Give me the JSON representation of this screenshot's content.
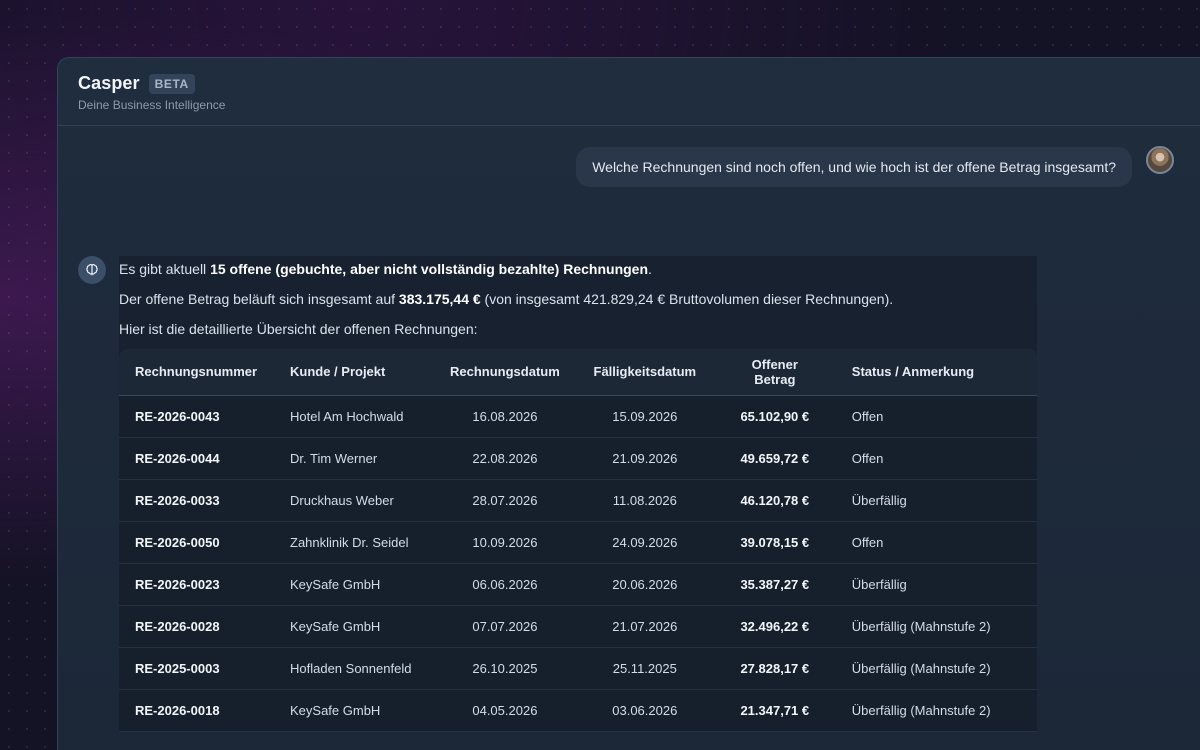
{
  "app": {
    "title": "Casper",
    "badge": "BETA",
    "subtitle": "Deine Business Intelligence"
  },
  "user_message": "Welche Rechnungen sind noch offen, und wie hoch ist der offene Betrag insgesamt?",
  "assistant": {
    "line1_prefix": "Es gibt aktuell ",
    "line1_bold": "15 offene (gebuchte, aber nicht vollständig bezahlte) Rechnungen",
    "line1_suffix": ".",
    "line2_prefix": "Der offene Betrag beläuft sich insgesamt auf ",
    "line2_bold": "383.175,44 €",
    "line2_suffix": " (von insgesamt 421.829,24 € Bruttovolumen dieser Rechnungen).",
    "line3": "Hier ist die detaillierte Übersicht der offenen Rechnungen:"
  },
  "table": {
    "headers": [
      "Rechnungsnummer",
      "Kunde / Projekt",
      "Rechnungsdatum",
      "Fälligkeitsdatum",
      "Offener Betrag",
      "Status / Anmerkung"
    ],
    "rows": [
      {
        "nr": "RE-2026-0043",
        "kunde": "Hotel Am Hochwald",
        "datum": "16.08.2026",
        "faellig": "15.09.2026",
        "betrag": "65.102,90 €",
        "status": "Offen"
      },
      {
        "nr": "RE-2026-0044",
        "kunde": "Dr. Tim Werner",
        "datum": "22.08.2026",
        "faellig": "21.09.2026",
        "betrag": "49.659,72 €",
        "status": "Offen"
      },
      {
        "nr": "RE-2026-0033",
        "kunde": "Druckhaus Weber",
        "datum": "28.07.2026",
        "faellig": "11.08.2026",
        "betrag": "46.120,78 €",
        "status": "Überfällig"
      },
      {
        "nr": "RE-2026-0050",
        "kunde": "Zahnklinik Dr. Seidel",
        "datum": "10.09.2026",
        "faellig": "24.09.2026",
        "betrag": "39.078,15 €",
        "status": "Offen"
      },
      {
        "nr": "RE-2026-0023",
        "kunde": "KeySafe GmbH",
        "datum": "06.06.2026",
        "faellig": "20.06.2026",
        "betrag": "35.387,27 €",
        "status": "Überfällig"
      },
      {
        "nr": "RE-2026-0028",
        "kunde": "KeySafe GmbH",
        "datum": "07.07.2026",
        "faellig": "21.07.2026",
        "betrag": "32.496,22 €",
        "status": "Überfällig (Mahnstufe 2)"
      },
      {
        "nr": "RE-2025-0003",
        "kunde": "Hofladen Sonnenfeld",
        "datum": "26.10.2025",
        "faellig": "25.11.2025",
        "betrag": "27.828,17 €",
        "status": "Überfällig (Mahnstufe 2)"
      },
      {
        "nr": "RE-2026-0018",
        "kunde": "KeySafe GmbH",
        "datum": "04.05.2026",
        "faellig": "03.06.2026",
        "betrag": "21.347,71 €",
        "status": "Überfällig (Mahnstufe 2)"
      }
    ]
  },
  "icons": {
    "assistant_avatar": "brain-icon",
    "user_avatar": "user-photo-avatar"
  }
}
